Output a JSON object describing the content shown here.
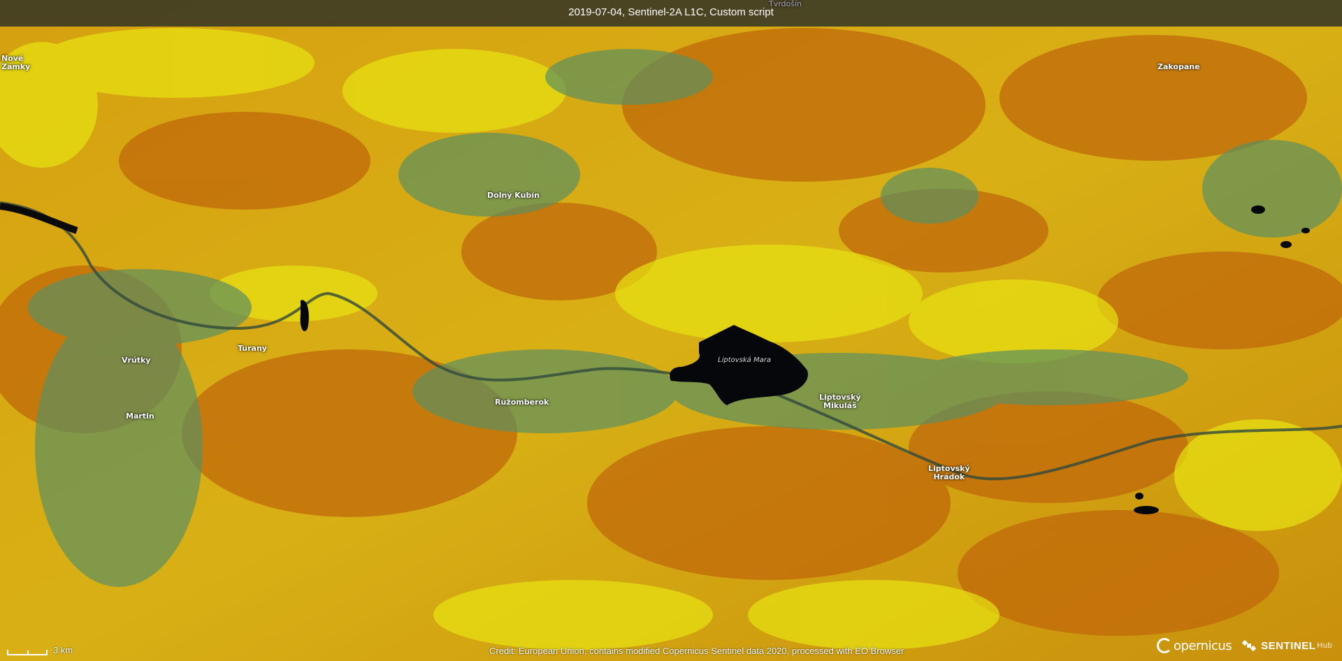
{
  "header": {
    "title": "2019-07-04, Sentinel-2A L1C, Custom script"
  },
  "places": {
    "nove": "Nové\nZámky",
    "tvrdosin": "Tvrdošín",
    "zakopane": "Zakopane",
    "dolny_kubin": "Dolný Kubín",
    "vrutky": "Vrútky",
    "turany": "Turany",
    "martin": "Martin",
    "ruzomberok": "Ružomberok",
    "liptovska_mara": "Liptovská Mara",
    "liptovsky_mikulas": "Liptovský\nMikuláš",
    "liptovsky_hradok": "Liptovský\nHrádok"
  },
  "scale": {
    "label": "3 km"
  },
  "credit": {
    "text": "Credit: European Union, contains modified Copernicus Sentinel data 2020, processed with EO Browser"
  },
  "logos": {
    "copernicus": "opernicus",
    "sentinel": "SENTINEL",
    "hub": "Hub"
  },
  "colors": {
    "orange": "#c8740a",
    "yellow": "#e6e010",
    "green_teal": "#4f8a5c",
    "water": "#05070a"
  }
}
